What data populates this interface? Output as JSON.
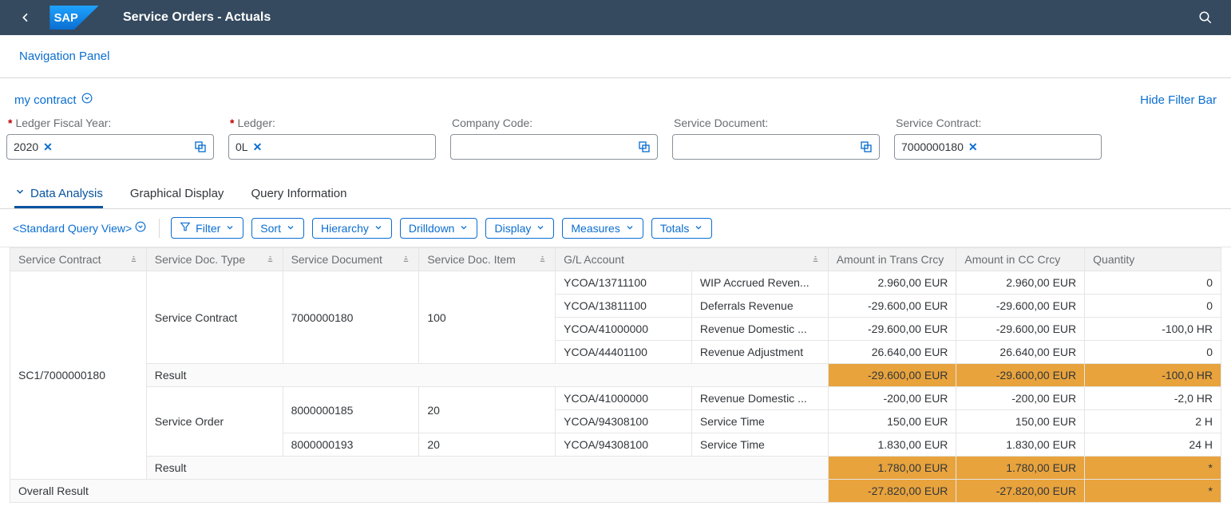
{
  "header": {
    "title": "Service Orders - Actuals"
  },
  "subheader": {
    "navPanel": "Navigation Panel"
  },
  "filterbar": {
    "variant": "my contract",
    "hideFilter": "Hide Filter Bar",
    "fields": {
      "ledgerFiscalYear": {
        "label": "Ledger Fiscal Year:",
        "token": "2020"
      },
      "ledger": {
        "label": "Ledger:",
        "token": "0L"
      },
      "companyCode": {
        "label": "Company Code:",
        "token": ""
      },
      "serviceDocument": {
        "label": "Service Document:",
        "token": ""
      },
      "serviceContract": {
        "label": "Service Contract:",
        "token": "7000000180"
      }
    }
  },
  "tabs": {
    "dataAnalysis": "Data Analysis",
    "graphicalDisplay": "Graphical Display",
    "queryInformation": "Query Information"
  },
  "toolbar": {
    "queryView": "<Standard Query View>",
    "filter": "Filter",
    "sort": "Sort",
    "hierarchy": "Hierarchy",
    "drilldown": "Drilldown",
    "display": "Display",
    "measures": "Measures",
    "totals": "Totals"
  },
  "table": {
    "columns": {
      "serviceContract": "Service Contract",
      "serviceDocType": "Service Doc. Type",
      "serviceDocument": "Service Document",
      "serviceDocItem": "Service Doc. Item",
      "glAccount": "G/L Account",
      "amountTrans": "Amount in Trans Crcy",
      "amountCC": "Amount in CC Crcy",
      "quantity": "Quantity"
    },
    "contractKey": "SC1/7000000180",
    "rows": [
      {
        "docType": "Service Contract",
        "doc": "7000000180",
        "item": "100",
        "gl": "YCOA/13711100",
        "glDesc": "WIP Accrued Reven...",
        "amtTrans": "2.960,00 EUR",
        "amtCC": "2.960,00 EUR",
        "qty": "0"
      },
      {
        "docType": "",
        "doc": "",
        "item": "",
        "gl": "YCOA/13811100",
        "glDesc": "Deferrals Revenue",
        "amtTrans": "-29.600,00 EUR",
        "amtCC": "-29.600,00 EUR",
        "qty": "0"
      },
      {
        "docType": "",
        "doc": "",
        "item": "",
        "gl": "YCOA/41000000",
        "glDesc": "Revenue Domestic ...",
        "amtTrans": "-29.600,00 EUR",
        "amtCC": "-29.600,00 EUR",
        "qty": "-100,0 HR"
      },
      {
        "docType": "",
        "doc": "",
        "item": "",
        "gl": "YCOA/44401100",
        "glDesc": "Revenue Adjustment",
        "amtTrans": "26.640,00 EUR",
        "amtCC": "26.640,00 EUR",
        "qty": "0"
      }
    ],
    "result1": {
      "label": "Result",
      "amtTrans": "-29.600,00 EUR",
      "amtCC": "-29.600,00 EUR",
      "qty": "-100,0 HR"
    },
    "rows2": [
      {
        "docType": "Service Order",
        "doc": "8000000185",
        "item": "20",
        "gl": "YCOA/41000000",
        "glDesc": "Revenue Domestic ...",
        "amtTrans": "-200,00 EUR",
        "amtCC": "-200,00 EUR",
        "qty": "-2,0 HR"
      },
      {
        "docType": "",
        "doc": "",
        "item": "",
        "gl": "YCOA/94308100",
        "glDesc": "Service Time",
        "amtTrans": "150,00 EUR",
        "amtCC": "150,00 EUR",
        "qty": "2 H"
      },
      {
        "docType": "",
        "doc": "8000000193",
        "item": "20",
        "gl": "YCOA/94308100",
        "glDesc": "Service Time",
        "amtTrans": "1.830,00 EUR",
        "amtCC": "1.830,00 EUR",
        "qty": "24 H"
      }
    ],
    "result2": {
      "label": "Result",
      "amtTrans": "1.780,00 EUR",
      "amtCC": "1.780,00 EUR",
      "qty": "*"
    },
    "overall": {
      "label": "Overall Result",
      "amtTrans": "-27.820,00 EUR",
      "amtCC": "-27.820,00 EUR",
      "qty": "*"
    }
  }
}
